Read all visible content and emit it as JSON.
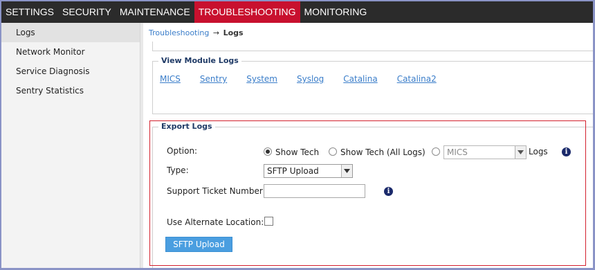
{
  "nav": {
    "tabs": [
      {
        "label": "SETTINGS"
      },
      {
        "label": "SECURITY"
      },
      {
        "label": "MAINTENANCE"
      },
      {
        "label": "TROUBLESHOOTING"
      },
      {
        "label": "MONITORING"
      }
    ],
    "active_tab": "TROUBLESHOOTING"
  },
  "sidebar": {
    "items": [
      {
        "label": "Logs"
      },
      {
        "label": "Network Monitor"
      },
      {
        "label": "Service Diagnosis"
      },
      {
        "label": "Sentry Statistics"
      }
    ],
    "selected": "Logs"
  },
  "breadcrumb": {
    "parent": "Troubleshooting",
    "separator": "→",
    "current": "Logs"
  },
  "view_module_logs": {
    "legend": "View Module Logs",
    "links": [
      {
        "label": "MICS"
      },
      {
        "label": "Sentry"
      },
      {
        "label": "System"
      },
      {
        "label": "Syslog"
      },
      {
        "label": "Catalina"
      },
      {
        "label": "Catalina2"
      }
    ]
  },
  "export_logs": {
    "legend": "Export Logs",
    "option_label": "Option:",
    "radio_show_tech": "Show Tech",
    "radio_show_tech_all": "Show Tech (All Logs)",
    "module_select_value": "MICS",
    "module_suffix": "Logs",
    "selected_option": "Show Tech",
    "type_label": "Type:",
    "type_value": "SFTP Upload",
    "ticket_label": "Support Ticket Number:",
    "ticket_value": "",
    "alt_location_label": "Use Alternate Location:",
    "alt_location_checked": false,
    "submit_label": "SFTP Upload"
  },
  "colors": {
    "nav_bg": "#2b2b2b",
    "active_tab": "#c8102e",
    "link": "#3a7dc9",
    "button": "#4a9ee0",
    "highlight_outline": "#d3202d",
    "info_icon": "#1b2a6b"
  }
}
